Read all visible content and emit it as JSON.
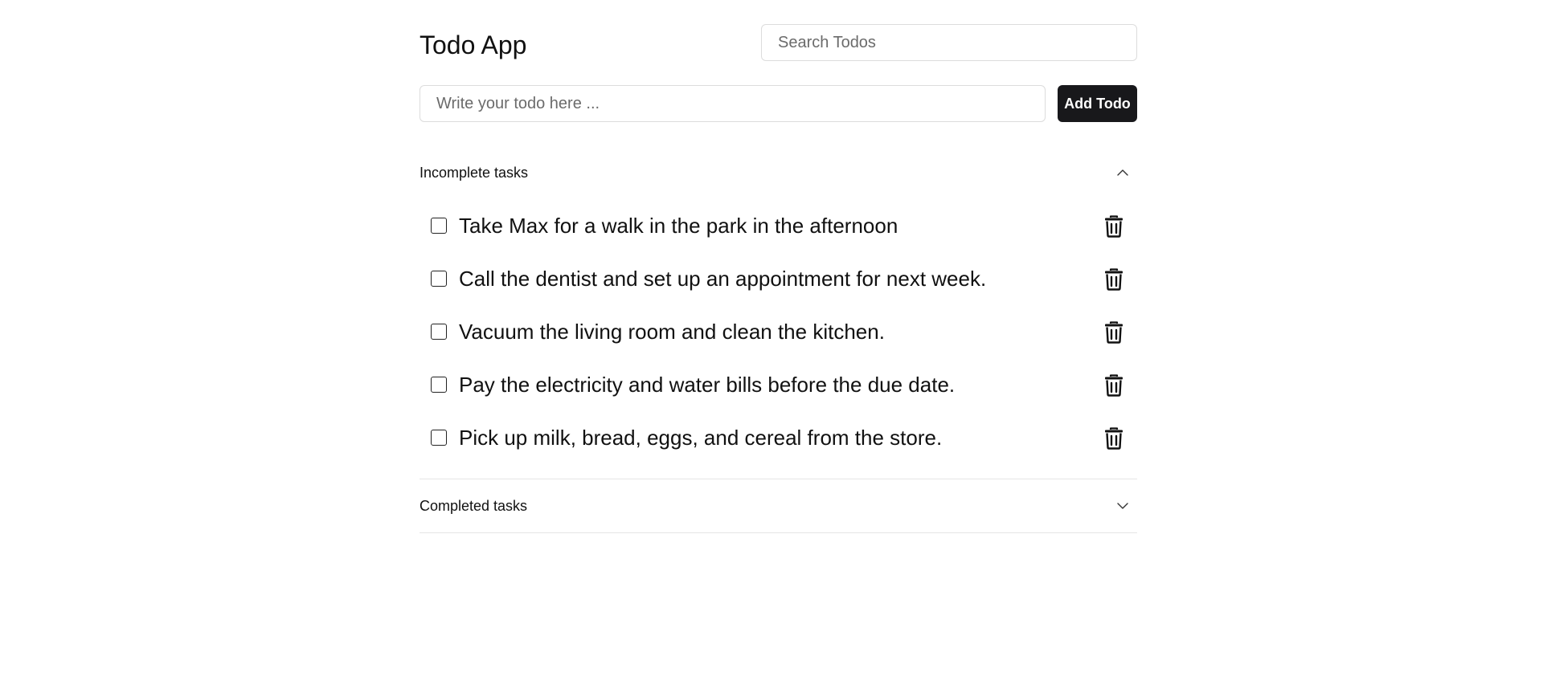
{
  "header": {
    "title": "Todo App",
    "search_placeholder": "Search Todos"
  },
  "add_todo": {
    "placeholder": "Write your todo here ...",
    "button_label": "Add Todo"
  },
  "incomplete_section": {
    "title": "Incomplete tasks",
    "expanded": true,
    "chevron_icon": "chevron-up-icon",
    "tasks": [
      {
        "text": "Take Max for a walk in the park in the afternoon",
        "checked": false
      },
      {
        "text": "Call the dentist and set up an appointment for next week.",
        "checked": false
      },
      {
        "text": "Vacuum the living room and clean the kitchen.",
        "checked": false
      },
      {
        "text": "Pay the electricity and water bills before the due date.",
        "checked": false
      },
      {
        "text": "Pick up milk, bread, eggs, and cereal from the store.",
        "checked": false
      }
    ],
    "delete_icon": "trash-icon"
  },
  "completed_section": {
    "title": "Completed tasks",
    "expanded": false,
    "chevron_icon": "chevron-down-icon"
  },
  "colors": {
    "button_bg": "#18181b",
    "button_text": "#ffffff",
    "border": "#dcdcdc",
    "divider": "#e5e5e5"
  }
}
